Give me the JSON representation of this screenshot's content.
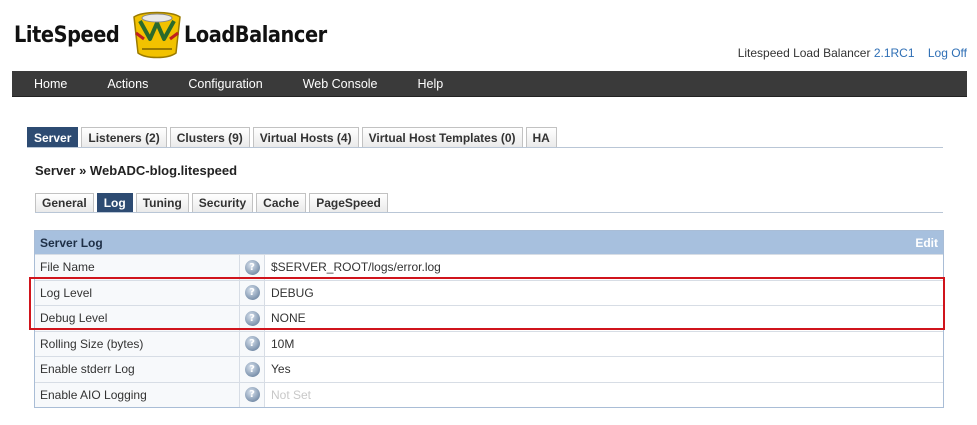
{
  "header": {
    "logo_word_1": "LiteSpeed",
    "logo_word_2": "LoadBalancer",
    "product": "Litespeed Load Balancer",
    "version": "2.1RC1",
    "logoff": "Log Off"
  },
  "nav": {
    "items": [
      "Home",
      "Actions",
      "Configuration",
      "Web Console",
      "Help"
    ]
  },
  "tabs_top": [
    "Server",
    "Listeners (2)",
    "Clusters (9)",
    "Virtual Hosts (4)",
    "Virtual Host Templates (0)",
    "HA"
  ],
  "breadcrumb": "Server » WebADC-blog.litespeed",
  "tabs_sub": [
    "General",
    "Log",
    "Tuning",
    "Security",
    "Cache",
    "PageSpeed"
  ],
  "panel": {
    "title": "Server Log",
    "edit": "Edit",
    "rows": [
      {
        "label": "File Name",
        "value": "$SERVER_ROOT/logs/error.log"
      },
      {
        "label": "Log Level",
        "value": "DEBUG"
      },
      {
        "label": "Debug Level",
        "value": "NONE"
      },
      {
        "label": "Rolling Size (bytes)",
        "value": "10M"
      },
      {
        "label": "Enable stderr Log",
        "value": "Yes"
      },
      {
        "label": "Enable AIO Logging",
        "value": "Not Set"
      }
    ]
  },
  "colors": {
    "navbar": "#3a3a3a",
    "active_tab": "#2d4b72",
    "panel_header": "#a7c0de",
    "highlight": "#d0141c",
    "link": "#2f6fb5"
  }
}
